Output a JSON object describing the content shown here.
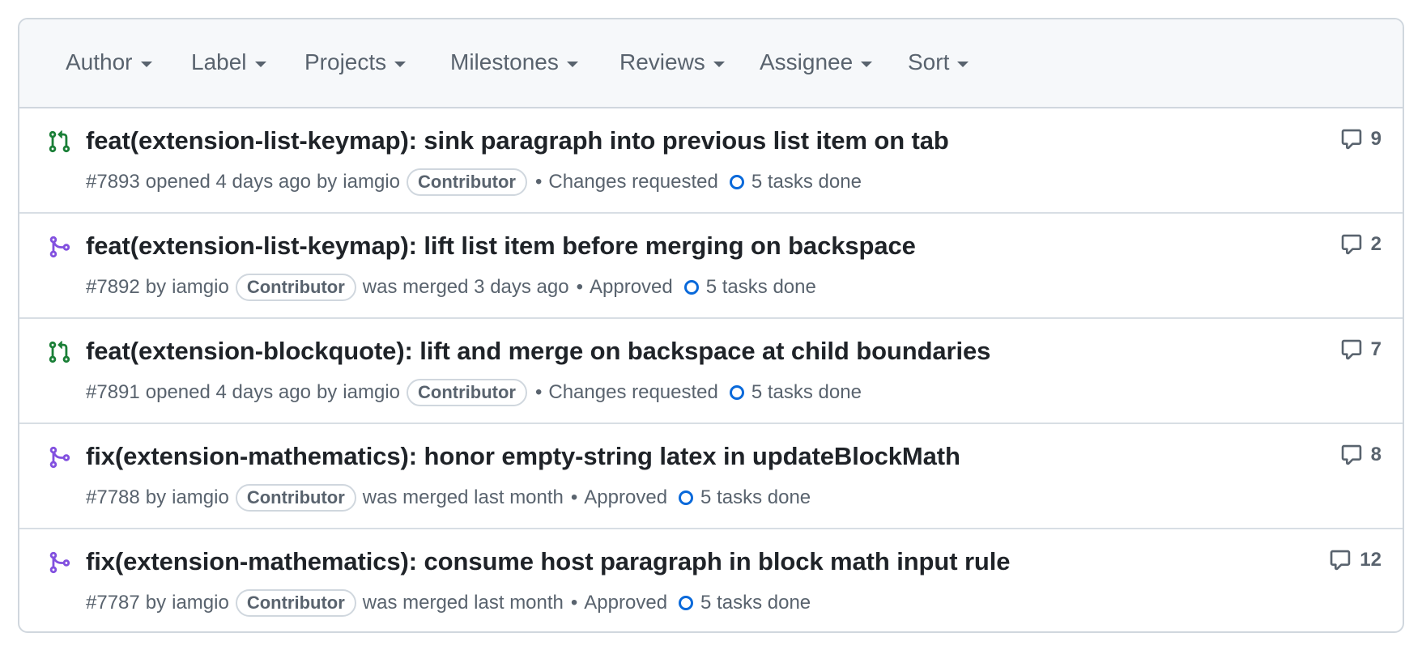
{
  "filters": [
    {
      "label": "Author"
    },
    {
      "label": "Label"
    },
    {
      "label": "Projects"
    },
    {
      "label": "Milestones"
    },
    {
      "label": "Reviews"
    },
    {
      "label": "Assignee"
    },
    {
      "label": "Sort"
    }
  ],
  "colors": {
    "open": "#1a7f37",
    "merged": "#8250df",
    "task_ring": "#0969da"
  },
  "pull_requests": [
    {
      "state_icon": "git-pull-request-open-icon",
      "title": "feat(extension-list-keymap): sink paragraph into previous list item on tab",
      "number": "#7893",
      "status_text": "opened 4 days ago",
      "by": "by",
      "author": "iamgio",
      "badge": "Contributor",
      "review": "Changes requested",
      "tasks": "5 tasks done",
      "comments": "9"
    },
    {
      "state_icon": "git-merge-icon",
      "title": "feat(extension-list-keymap): lift list item before merging on backspace",
      "number": "#7892",
      "status_text": "was merged 3 days ago",
      "by": "by",
      "author": "iamgio",
      "badge": "Contributor",
      "review": "Approved",
      "tasks": "5 tasks done",
      "comments": "2"
    },
    {
      "state_icon": "git-pull-request-open-icon",
      "title": "feat(extension-blockquote): lift and merge on backspace at child boundaries",
      "number": "#7891",
      "status_text": "opened 4 days ago",
      "by": "by",
      "author": "iamgio",
      "badge": "Contributor",
      "review": "Changes requested",
      "tasks": "5 tasks done",
      "comments": "7"
    },
    {
      "state_icon": "git-merge-icon",
      "title": "fix(extension-mathematics): honor empty-string latex in updateBlockMath",
      "number": "#7788",
      "status_text": "was merged last month",
      "by": "by",
      "author": "iamgio",
      "badge": "Contributor",
      "review": "Approved",
      "tasks": "5 tasks done",
      "comments": "8"
    },
    {
      "state_icon": "git-merge-icon",
      "title": "fix(extension-mathematics): consume host paragraph in block math input rule",
      "number": "#7787",
      "status_text": "was merged last month",
      "by": "by",
      "author": "iamgio",
      "badge": "Contributor",
      "review": "Approved",
      "tasks": "5 tasks done",
      "comments": "12"
    }
  ]
}
